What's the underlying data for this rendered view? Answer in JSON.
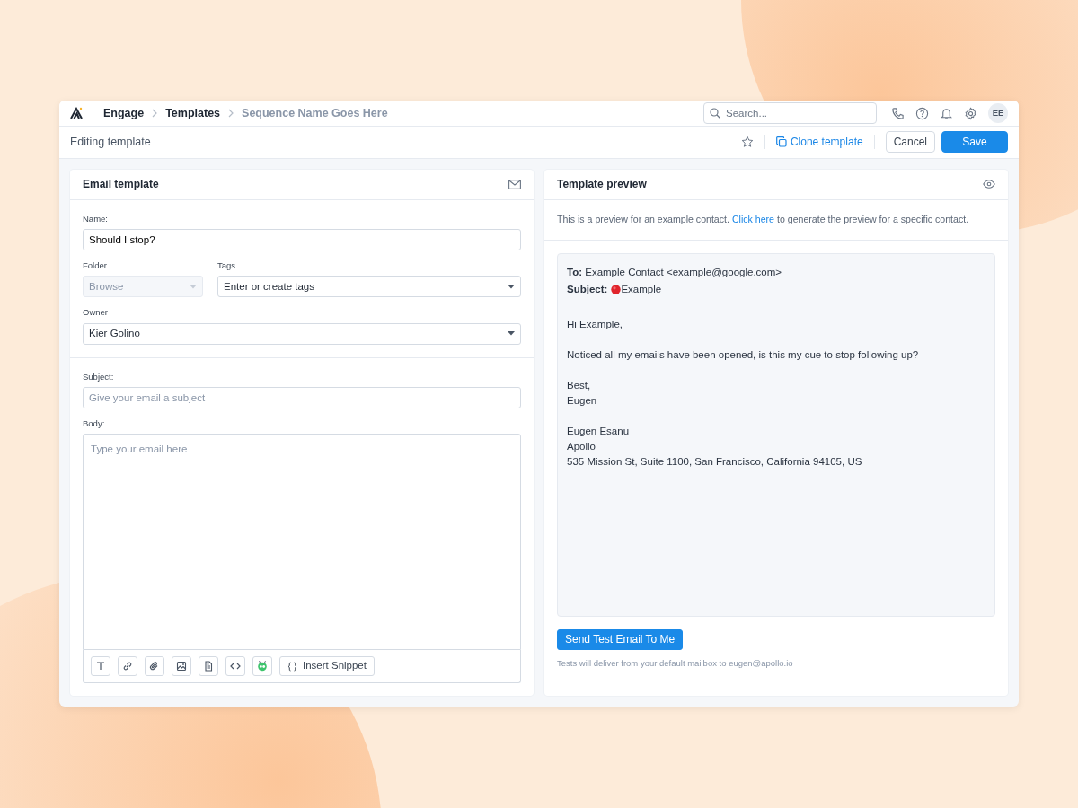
{
  "breadcrumbs": [
    {
      "label": "Engage",
      "current": false
    },
    {
      "label": "Templates",
      "current": false
    },
    {
      "label": "Sequence Name Goes Here",
      "current": true
    }
  ],
  "search": {
    "placeholder": "Search..."
  },
  "avatar": {
    "initials": "EE"
  },
  "toolbar": {
    "title": "Editing template",
    "starred": false,
    "clone": "Clone template",
    "cancel": "Cancel",
    "save": "Save"
  },
  "email_template": {
    "title": "Email template",
    "name": {
      "label": "Name:",
      "value": "Should I stop?"
    },
    "folder": {
      "label": "Folder",
      "value": "Browse",
      "disabled": true
    },
    "tags": {
      "label": "Tags",
      "value": "Enter or create tags",
      "disabled": false
    },
    "owner": {
      "label": "Owner",
      "value": "Kier Golino",
      "disabled": false
    },
    "subject": {
      "label": "Subject:",
      "placeholder": "Give your email a subject"
    },
    "body": {
      "label": "Body:",
      "placeholder": "Type your email here"
    },
    "tools": [
      {
        "kind": "text"
      },
      {
        "kind": "link"
      },
      {
        "kind": "attachment"
      },
      {
        "kind": "image"
      },
      {
        "kind": "document"
      },
      {
        "kind": "code"
      },
      {
        "kind": "bot"
      }
    ],
    "snippet": "Insert Snippet"
  },
  "preview": {
    "title": "Template preview",
    "intro_before": "This is a preview for an example contact.",
    "intro_link": "Click here",
    "intro_after": "to generate the preview for a specific contact.",
    "to_label": "To:",
    "to": "Example Contact <example@google.com>",
    "subject_label": "Subject:",
    "subject": "Example",
    "paragraphs": [
      [
        "Hi Example,"
      ],
      [
        "Noticed all my emails have been opened, is this my cue to stop following up?"
      ],
      [
        "Best,",
        "Eugen"
      ],
      [
        "Eugen Esanu",
        "Apollo",
        "535 Mission St, Suite 1100, San Francisco, California 94105, US"
      ]
    ],
    "send": "Send Test Email To Me",
    "note": "Tests will deliver from your default mailbox to eugen@apollo.io"
  }
}
